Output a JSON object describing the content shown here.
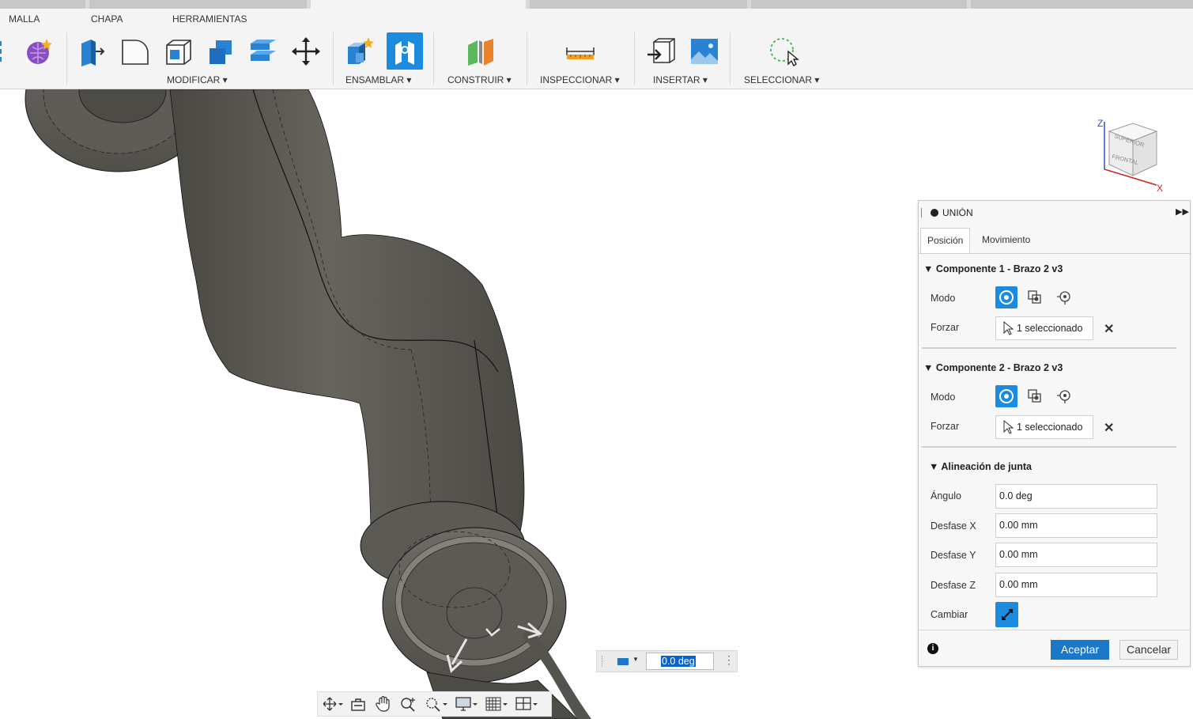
{
  "ribbon": {
    "tabs": [
      "MALLA",
      "CHAPA",
      "HERRAMIENTAS"
    ],
    "groups": {
      "modificar": "MODIFICAR ▾",
      "ensamblar": "ENSAMBLAR ▾",
      "construir": "CONSTRUIR ▾",
      "inspeccionar": "INSPECCIONAR ▾",
      "insertar": "INSERTAR ▾",
      "seleccionar": "SELECCIONAR ▾"
    },
    "icons": [
      "form-icon",
      "create-form-icon",
      "press-pull-icon",
      "fillet-icon",
      "shell-icon",
      "combine-icon",
      "align-icon",
      "move-icon",
      "new-component-icon",
      "joint-icon",
      "plane-icon",
      "measure-icon",
      "insert-derive-icon",
      "canvas-icon",
      "select-icon"
    ]
  },
  "viewcube": {
    "top": "SUPERIOR",
    "front": "FRONTAL",
    "axis_z": "Z",
    "axis_x": "X"
  },
  "panel": {
    "title": "UNIÓN",
    "tabs": [
      "Posición",
      "Movimiento"
    ],
    "component1": {
      "title": "Componente 1 - Brazo 2 v3",
      "mode_label": "Modo",
      "snap_label": "Forzar",
      "snap_value": "1 seleccionado"
    },
    "component2": {
      "title": "Componente 2 - Brazo 2 v3",
      "mode_label": "Modo",
      "snap_label": "Forzar",
      "snap_value": "1 seleccionado"
    },
    "alignment": {
      "title": "Alineación de junta",
      "angle_label": "Ángulo",
      "angle_value": "0.0 deg",
      "offset_x_label": "Desfase X",
      "offset_x_value": "0.00 mm",
      "offset_y_label": "Desfase Y",
      "offset_y_value": "0.00 mm",
      "offset_z_label": "Desfase Z",
      "offset_z_value": "0.00 mm",
      "flip_label": "Cambiar"
    },
    "ok": "Aceptar",
    "cancel": "Cancelar"
  },
  "value_input": {
    "value": "0.0 deg"
  },
  "navbar": {
    "icons": [
      "orbit-icon",
      "look-at-icon",
      "pan-icon",
      "zoom-icon",
      "fit-icon",
      "display-settings-icon",
      "grid-icon",
      "viewports-icon"
    ]
  },
  "colors": {
    "accent": "#1b8be0",
    "model": "#5e5b55",
    "ok_button": "#1b78c8"
  }
}
